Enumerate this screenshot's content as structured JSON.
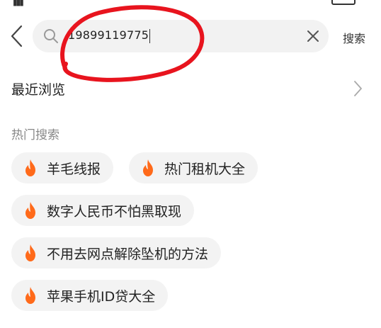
{
  "search": {
    "query": "19899119775",
    "submit_label": "搜索"
  },
  "recent": {
    "label": "最近浏览"
  },
  "hot": {
    "label": "热门搜索",
    "chips": [
      "羊毛线报",
      "热门租机大全",
      "数字人民币不怕黑取现",
      "不用去网点解除坠机的方法",
      "苹果手机ID贷大全"
    ]
  },
  "colors": {
    "flame": "#ff6a1a",
    "annotation": "#e8141e",
    "chip_bg": "#f3f3f3",
    "search_bg": "#f2f2f2"
  }
}
